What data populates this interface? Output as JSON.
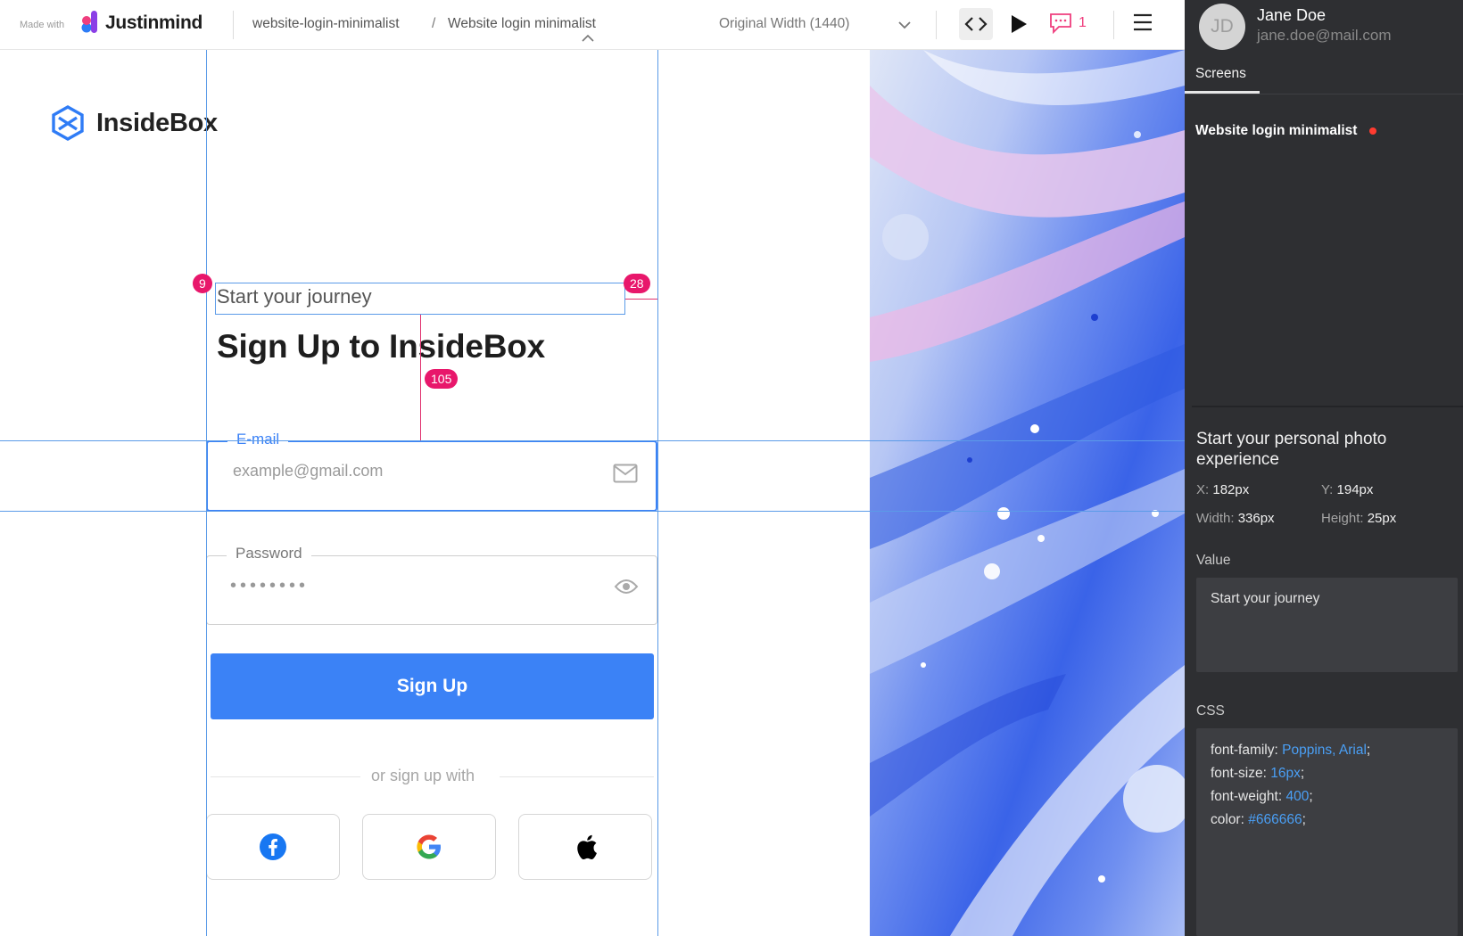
{
  "topbar": {
    "made_with": "Made with",
    "brand": "Justinmind",
    "breadcrumb": {
      "project": "website-login-minimalist",
      "separator": "/",
      "screen": "Website login minimalist"
    },
    "width_select": "Original Width (1440)",
    "comment_count": "1",
    "icons": [
      "chevron-up-icon",
      "chevron-down-icon",
      "code-icon",
      "play-icon",
      "comment-icon",
      "hamburger-menu-icon"
    ]
  },
  "canvas": {
    "logo_text": "InsideBox",
    "subtitle": "Start your journey",
    "heading": "Sign Up to InsideBox",
    "email": {
      "label": "E-mail",
      "placeholder": "example@gmail.com",
      "icon": "mail-icon"
    },
    "password": {
      "label": "Password",
      "value": "••••••••",
      "icon": "eye-icon"
    },
    "signup_button": "Sign Up",
    "divider_text": "or sign up with",
    "social": [
      "facebook-icon",
      "google-icon",
      "apple-icon"
    ],
    "guides": {
      "left_offset": "9",
      "right_offset": "28",
      "gap": "105"
    },
    "colors": {
      "accent": "#3b82f6",
      "measure": "#e8176b"
    }
  },
  "panel": {
    "user": {
      "initials": "JD",
      "name": "Jane Doe",
      "email": "jane.doe@mail.com"
    },
    "tab": "Screens",
    "screen_item": "Website login minimalist",
    "properties": {
      "title": "Start your personal photo experience",
      "x_label": "X:",
      "x_value": "182px",
      "y_label": "Y:",
      "y_value": "194px",
      "width_label": "Width:",
      "width_value": "336px",
      "height_label": "Height:",
      "height_value": "25px"
    },
    "value_label": "Value",
    "value_text": "Start your journey",
    "css_label": "CSS",
    "css": [
      {
        "prop": "font-family:",
        "val": "Poppins, Arial",
        "end": ";"
      },
      {
        "prop": "font-size:",
        "val": "16px",
        "end": ";"
      },
      {
        "prop": "font-weight:",
        "val": "400",
        "end": ";"
      },
      {
        "prop": "color:",
        "val": "#666666",
        "end": ";"
      }
    ]
  }
}
